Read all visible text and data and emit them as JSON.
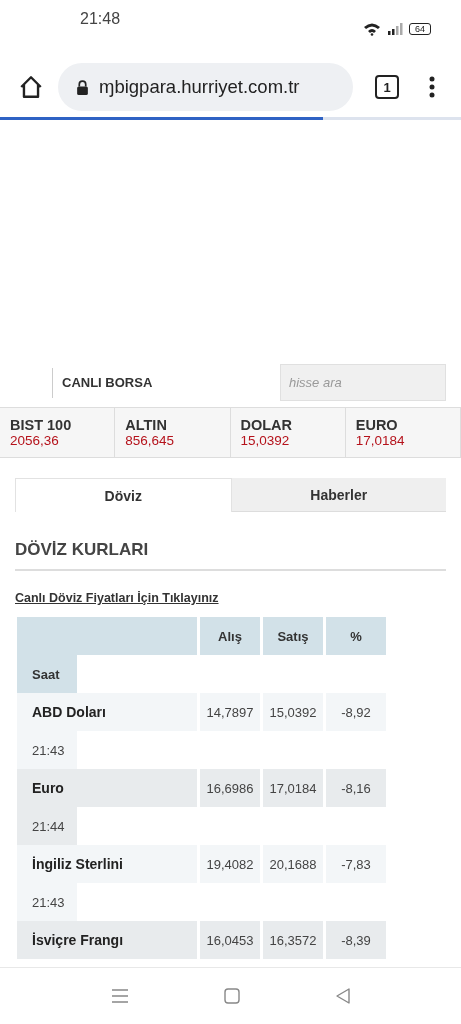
{
  "status_bar": {
    "time": "21:48",
    "battery": "64"
  },
  "browser": {
    "url": "ɱbigpara.hurriyet.com.tr",
    "tab_count": "1",
    "load_progress": {
      "level": 0.7
    }
  },
  "page": {
    "section_title": "CANLI BORSA",
    "search": {
      "placeholder": "hisse ara"
    },
    "tickers": [
      {
        "name": "BIST 100",
        "value": "2056,36"
      },
      {
        "name": "ALTIN",
        "value": "856,645"
      },
      {
        "name": "DOLAR",
        "value": "15,0392"
      },
      {
        "name": "EURO",
        "value": "17,0184"
      }
    ],
    "tabs": [
      {
        "label": "Döviz",
        "selected": true
      },
      {
        "label": "Haberler",
        "selected": false
      }
    ],
    "heading": "DÖVİZ KURLARI",
    "link": "Canlı Döviz Fiyatları İçin Tıklayınız",
    "table": {
      "columns": [
        "Alış",
        "Satış",
        "%"
      ],
      "time_header": "Saat",
      "rows": [
        {
          "name": "ABD Doları",
          "buy": "14,7897",
          "sell": "15,0392",
          "change": "-8,92",
          "time": "21:43"
        },
        {
          "name": "Euro",
          "buy": "16,6986",
          "sell": "17,0184",
          "change": "-8,16",
          "time": "21:44"
        },
        {
          "name": "İngiliz Sterlini",
          "buy": "19,4082",
          "sell": "20,1688",
          "change": "-7,83",
          "time": "21:43"
        },
        {
          "name": "İsviçre Frangı",
          "buy": "16,0453",
          "sell": "16,3572",
          "change": "-8,39"
        }
      ]
    }
  }
}
